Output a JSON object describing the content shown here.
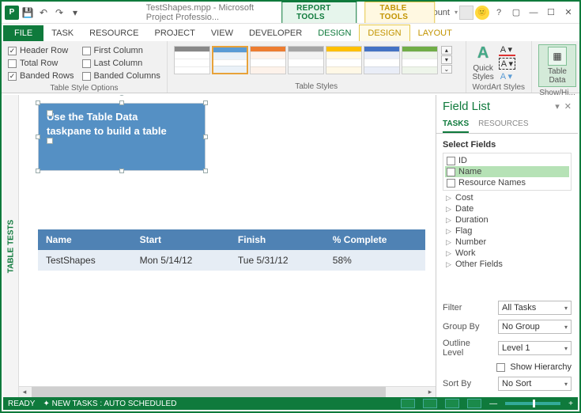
{
  "titlebar": {
    "filename": "TestShapes.mpp - Microsoft Project Professio...",
    "context_tabs": {
      "report": "REPORT TOOLS",
      "table": "TABLE TOOLS"
    },
    "account": "PKM Labnet Account"
  },
  "ribbon_tabs": {
    "file": "FILE",
    "task": "TASK",
    "resource": "RESOURCE",
    "project": "PROJECT",
    "view": "VIEW",
    "developer": "DEVELOPER",
    "design1": "DESIGN",
    "design2": "DESIGN",
    "layout": "LAYOUT"
  },
  "style_options": {
    "header_row": "Header Row",
    "first_col": "First Column",
    "total_row": "Total Row",
    "last_col": "Last Column",
    "banded_rows": "Banded Rows",
    "banded_cols": "Banded Columns",
    "group": "Table Style Options"
  },
  "groups": {
    "table_styles": "Table Styles",
    "wordart": "WordArt Styles",
    "quick_styles": "Quick\nStyles",
    "showhide": "Show/Hi...",
    "table_data": "Table\nData"
  },
  "textbox": {
    "line1": "Use the Table Data",
    "line2": "taskpane to build a table"
  },
  "vtab": "TABLE TESTS",
  "table": {
    "headers": {
      "name": "Name",
      "start": "Start",
      "finish": "Finish",
      "pct": "% Complete"
    },
    "row": {
      "name": "TestShapes",
      "start": "Mon 5/14/12",
      "finish": "Tue 5/31/12",
      "pct": "58%"
    }
  },
  "pane": {
    "title": "Field List",
    "tabs": {
      "tasks": "TASKS",
      "resources": "RESOURCES"
    },
    "select_fields": "Select Fields",
    "fields": {
      "id": "ID",
      "name": "Name",
      "resnames": "Resource Names"
    },
    "tree": {
      "cost": "Cost",
      "date": "Date",
      "duration": "Duration",
      "flag": "Flag",
      "number": "Number",
      "work": "Work",
      "other": "Other Fields"
    },
    "filter_l": "Filter",
    "filter_v": "All Tasks",
    "group_l": "Group By",
    "group_v": "No Group",
    "outline_l": "Outline Level",
    "outline_v": "Level 1",
    "showh": "Show Hierarchy",
    "sort_l": "Sort By",
    "sort_v": "No Sort"
  },
  "status": {
    "ready": "READY",
    "sched": "NEW TASKS : AUTO SCHEDULED"
  }
}
